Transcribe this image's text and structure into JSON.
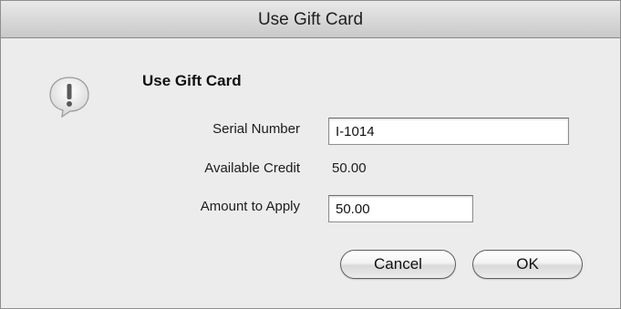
{
  "window": {
    "title": "Use Gift Card"
  },
  "dialog": {
    "icon": "alert-icon",
    "heading": "Use Gift Card",
    "serial_number": {
      "label": "Serial Number",
      "value": "I-1014"
    },
    "available_credit": {
      "label": "Available Credit",
      "value": "50.00"
    },
    "amount_to_apply": {
      "label": "Amount to Apply",
      "value": "50.00"
    }
  },
  "buttons": {
    "cancel": "Cancel",
    "ok": "OK"
  }
}
